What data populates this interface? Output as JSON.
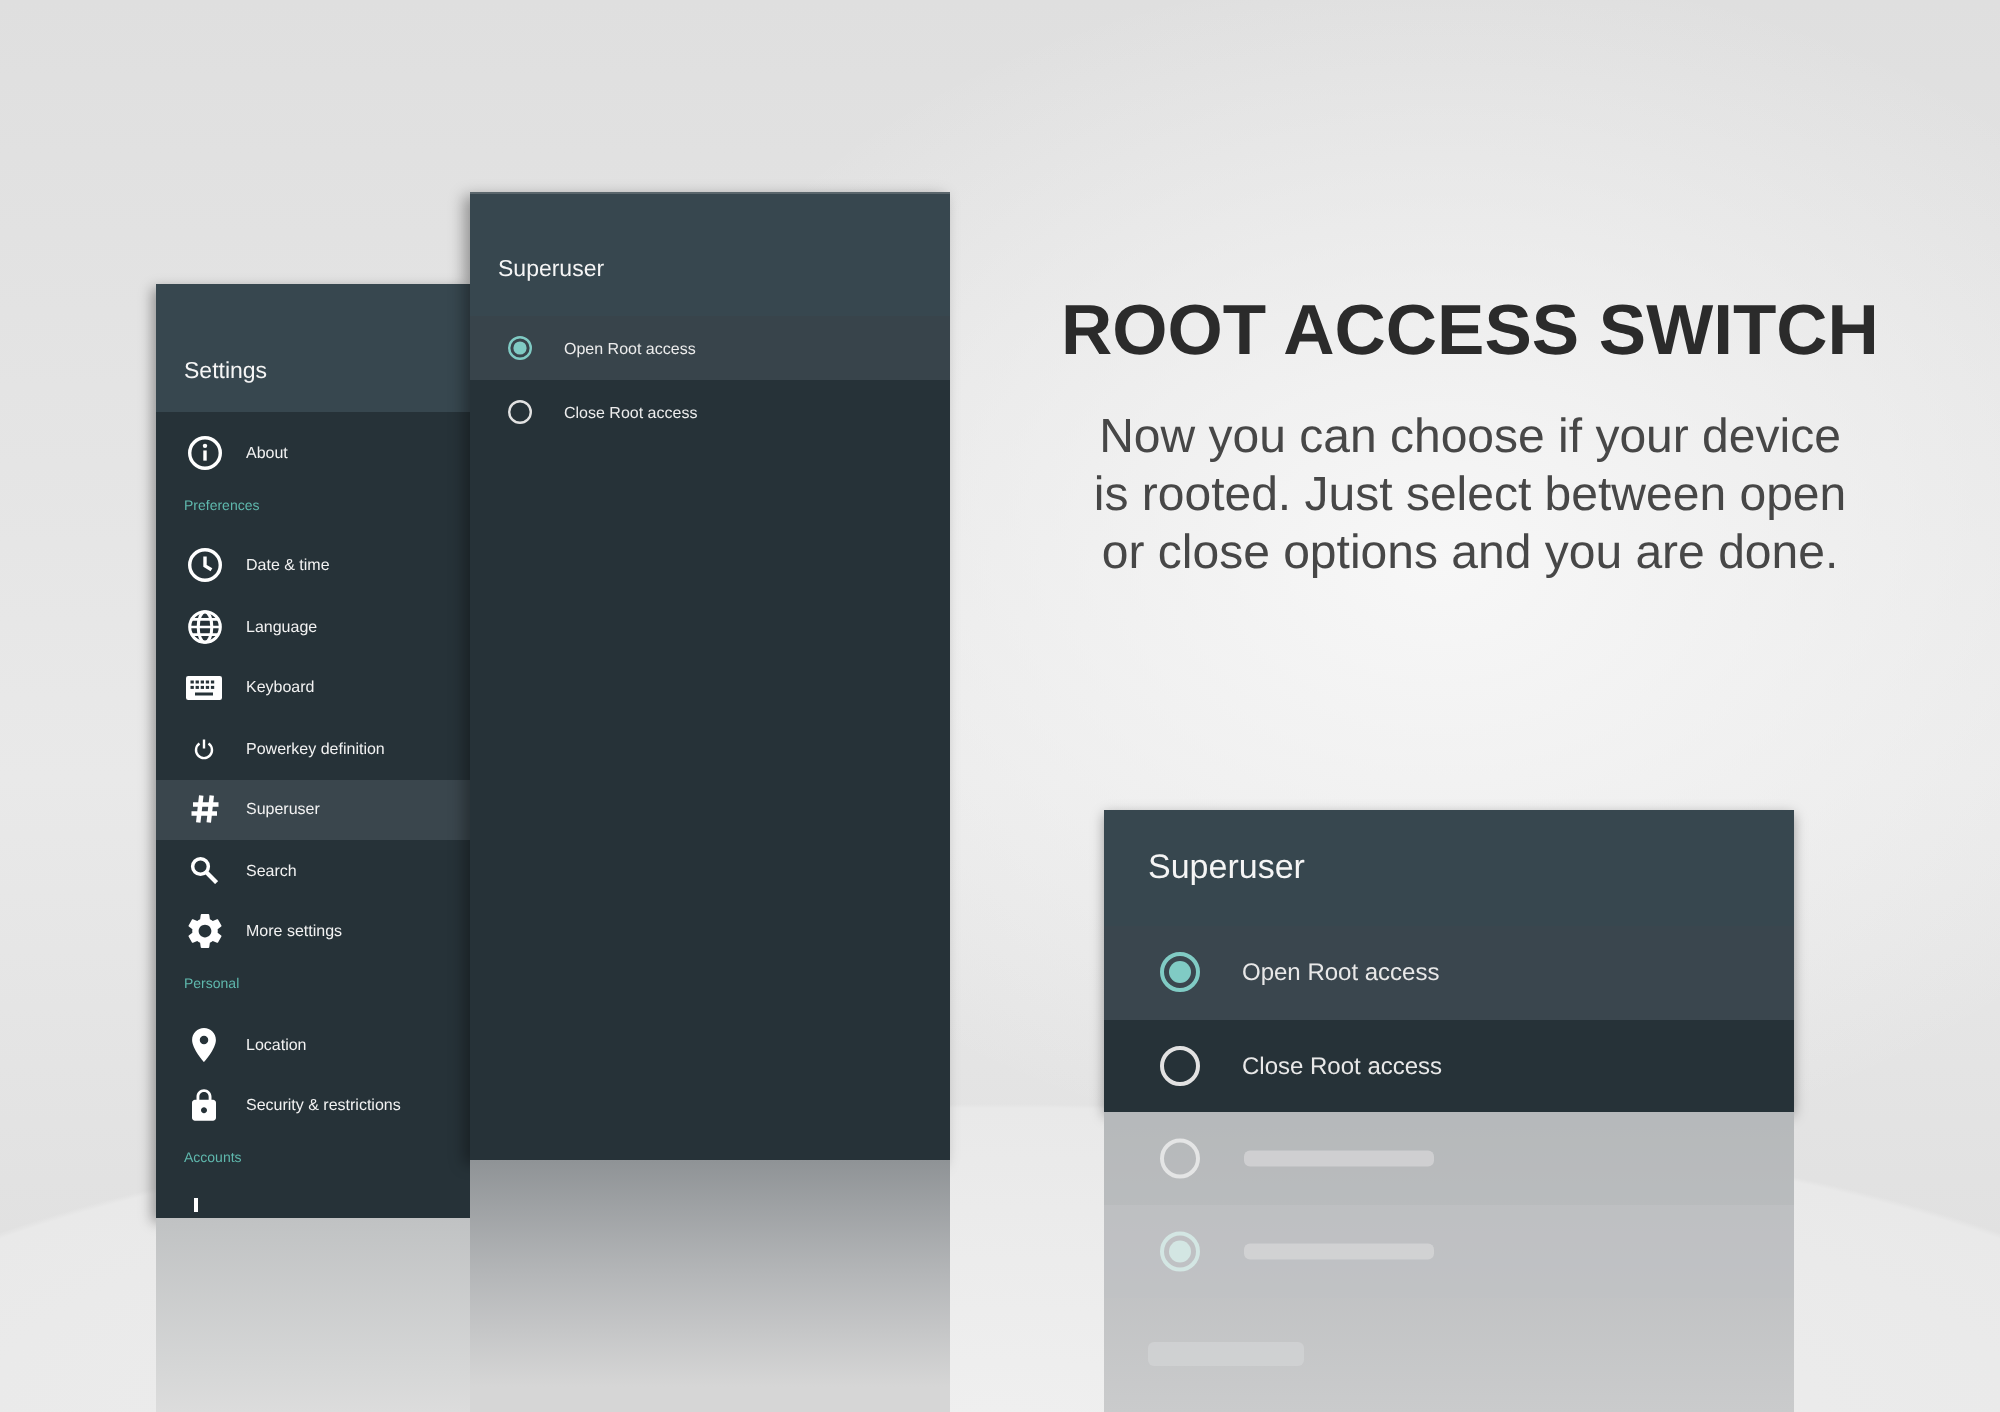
{
  "settings_panel": {
    "title": "Settings",
    "sections": [
      {
        "items": [
          {
            "label": "About",
            "selected": false
          }
        ]
      },
      {
        "header": "Preferences",
        "items": [
          {
            "label": "Date & time",
            "selected": false
          },
          {
            "label": "Language",
            "selected": false
          },
          {
            "label": "Keyboard",
            "selected": false
          },
          {
            "label": "Powerkey definition",
            "selected": false
          },
          {
            "label": "Superuser",
            "selected": true
          },
          {
            "label": "Search",
            "selected": false
          },
          {
            "label": "More settings",
            "selected": false
          }
        ]
      },
      {
        "header": "Personal",
        "items": [
          {
            "label": "Location",
            "selected": false
          },
          {
            "label": "Security & restrictions",
            "selected": false
          }
        ]
      },
      {
        "header": "Accounts"
      }
    ]
  },
  "superuser_panel": {
    "title": "Superuser",
    "options": [
      {
        "label": "Open Root access",
        "selected": true
      },
      {
        "label": "Close Root access",
        "selected": false
      }
    ]
  },
  "headline": "ROOT ACCESS SWITCH",
  "description": "Now you can choose if your device is rooted. Just select between open or close options and you are done.",
  "superuser_card": {
    "title": "Superuser",
    "options": [
      {
        "label": "Open Root access",
        "selected": true
      },
      {
        "label": "Close Root access",
        "selected": false
      }
    ]
  }
}
